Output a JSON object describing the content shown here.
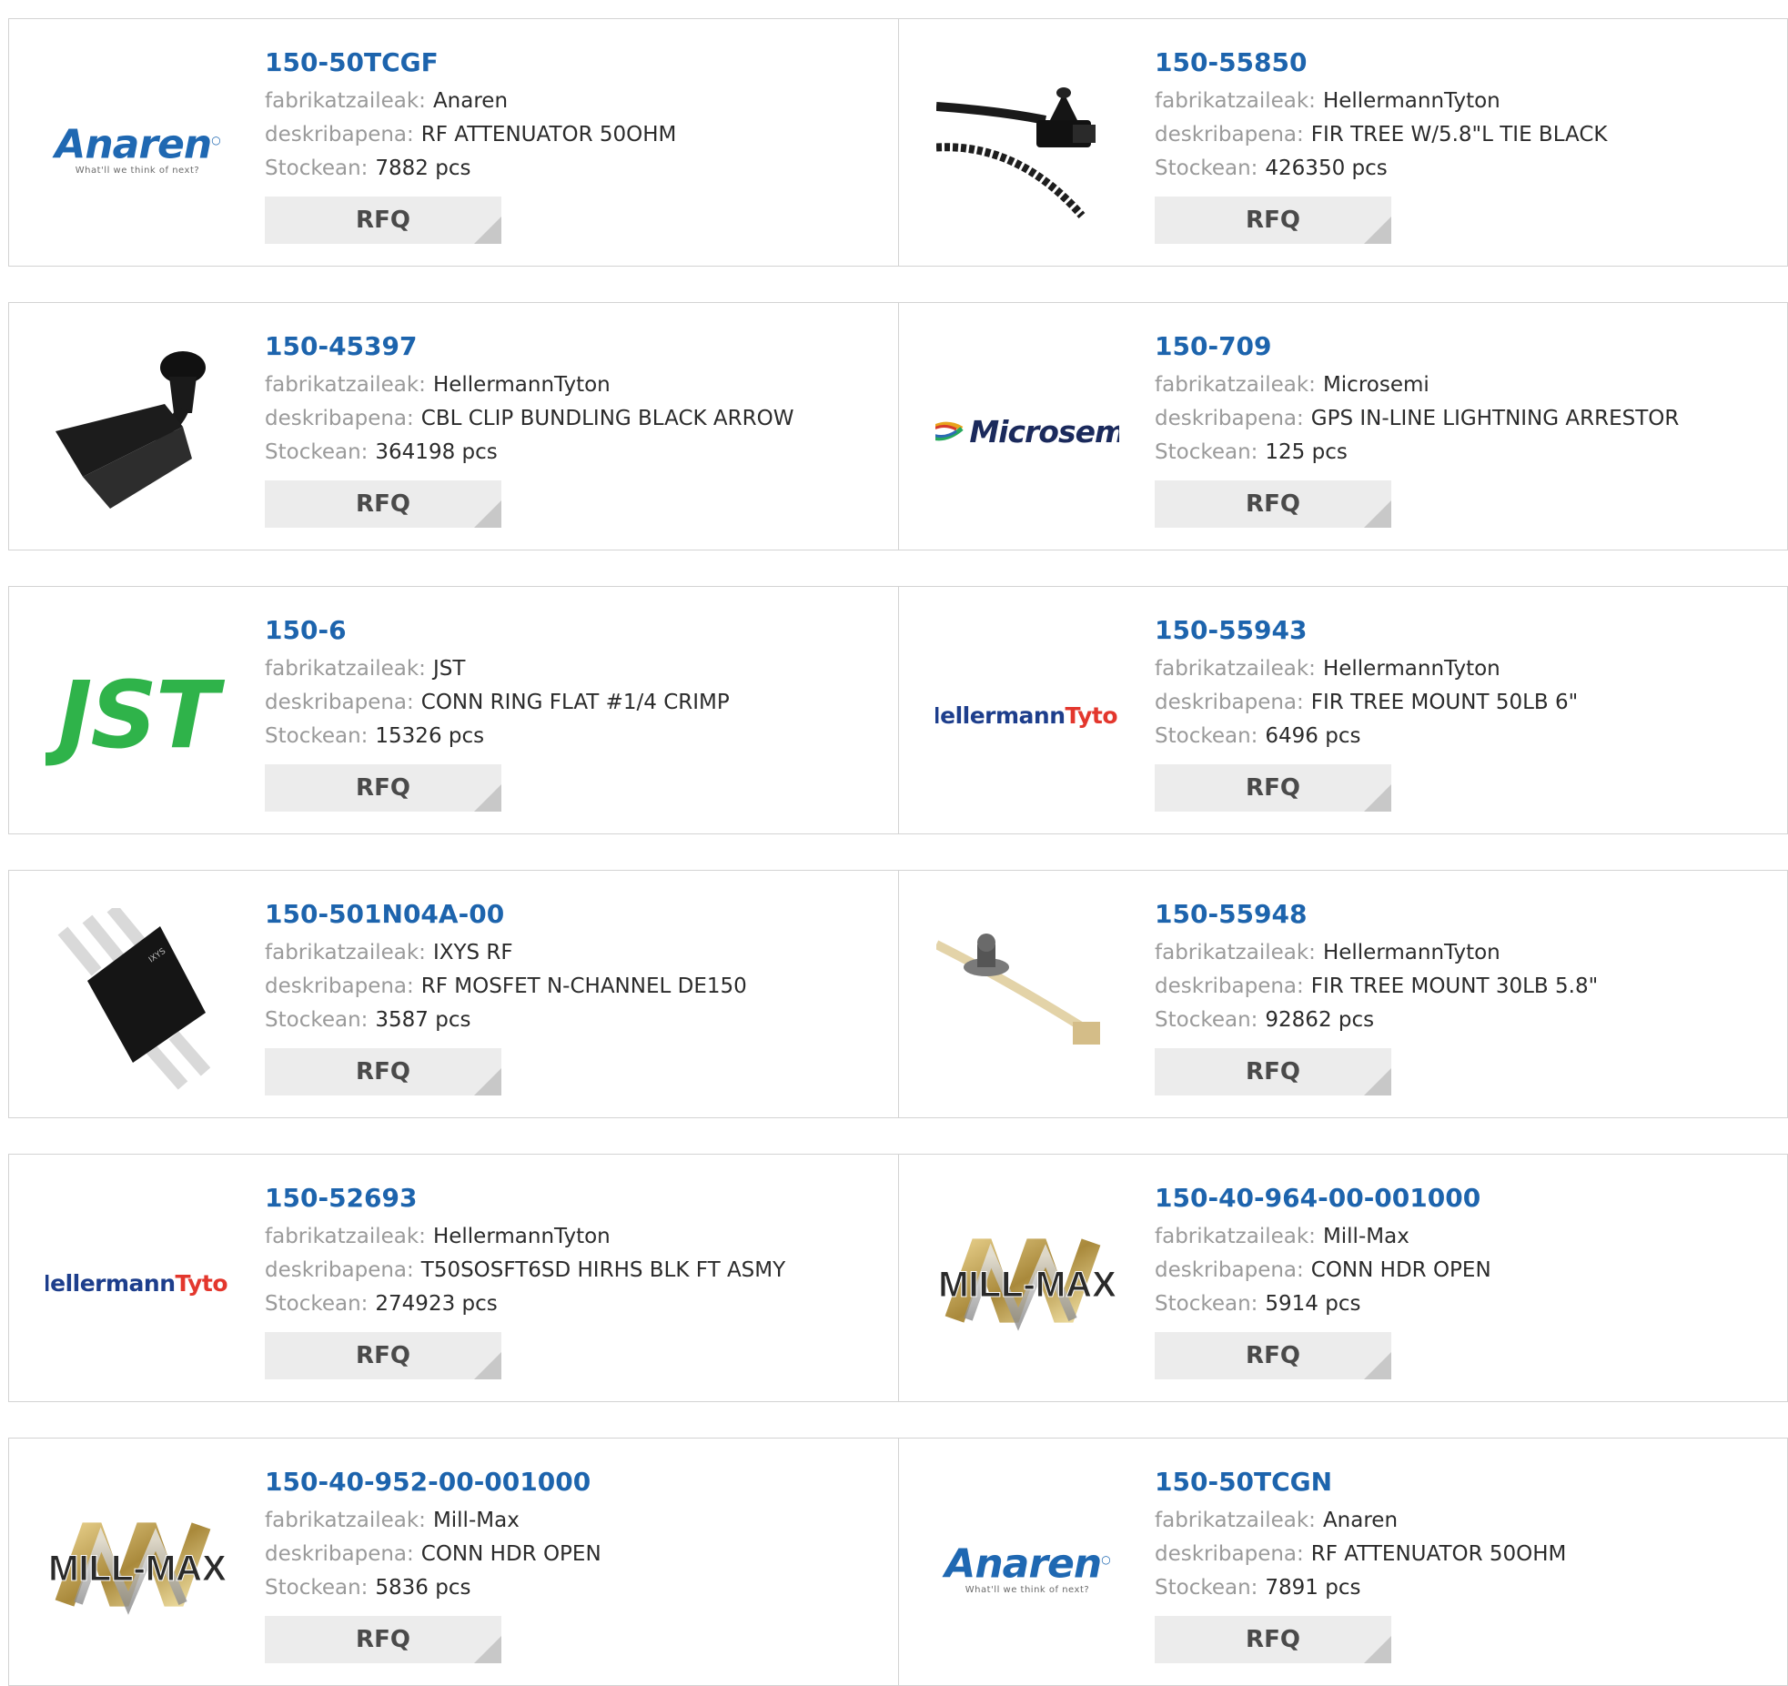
{
  "labels": {
    "manufacturer": "fabrikatzaileak:",
    "description": "deskribapena:",
    "stock": "Stockean:",
    "rfq": "RFQ"
  },
  "products": [
    {
      "part": "150-50TCGF",
      "manufacturer": "Anaren",
      "description": "RF ATTENUATOR 50OHM",
      "stock": "7882 pcs",
      "image": "anaren-logo"
    },
    {
      "part": "150-55850",
      "manufacturer": "HellermannTyton",
      "description": "FIR TREE W/5.8\"L TIE BLACK",
      "stock": "426350 pcs",
      "image": "fir-tree-black-tie-photo"
    },
    {
      "part": "150-45397",
      "manufacturer": "HellermannTyton",
      "description": "CBL CLIP BUNDLING BLACK ARROW",
      "stock": "364198 pcs",
      "image": "cable-clip-photo"
    },
    {
      "part": "150-709",
      "manufacturer": "Microsemi",
      "description": "GPS IN-LINE LIGHTNING ARRESTOR",
      "stock": "125 pcs",
      "image": "microsemi-logo"
    },
    {
      "part": "150-6",
      "manufacturer": "JST",
      "description": "CONN RING FLAT #1/4 CRIMP",
      "stock": "15326 pcs",
      "image": "jst-logo"
    },
    {
      "part": "150-55943",
      "manufacturer": "HellermannTyton",
      "description": "FIR TREE MOUNT 50LB 6\"",
      "stock": "6496 pcs",
      "image": "hellermanntyton-logo"
    },
    {
      "part": "150-501N04A-00",
      "manufacturer": "IXYS RF",
      "description": "RF MOSFET N-CHANNEL DE150",
      "stock": "3587 pcs",
      "image": "mosfet-photo"
    },
    {
      "part": "150-55948",
      "manufacturer": "HellermannTyton",
      "description": "FIR TREE MOUNT 30LB 5.8\"",
      "stock": "92862 pcs",
      "image": "fir-tree-natural-tie-photo"
    },
    {
      "part": "150-52693",
      "manufacturer": "HellermannTyton",
      "description": "T50SOSFT6SD HIRHS BLK FT ASMY",
      "stock": "274923 pcs",
      "image": "hellermanntyton-logo"
    },
    {
      "part": "150-40-964-00-001000",
      "manufacturer": "Mill-Max",
      "description": "CONN HDR OPEN",
      "stock": "5914 pcs",
      "image": "mill-max-logo"
    },
    {
      "part": "150-40-952-00-001000",
      "manufacturer": "Mill-Max",
      "description": "CONN HDR OPEN",
      "stock": "5836 pcs",
      "image": "mill-max-logo"
    },
    {
      "part": "150-50TCGN",
      "manufacturer": "Anaren",
      "description": "RF ATTENUATOR 50OHM",
      "stock": "7891 pcs",
      "image": "anaren-logo"
    }
  ],
  "logos": {
    "anaren": {
      "name": "Anaren",
      "tagline": "What'll we think of next?"
    },
    "jst": {
      "name": "JST"
    },
    "microsemi": {
      "name": "Microsemi"
    },
    "hellermann": {
      "part1": "Hellermann",
      "part2": "Tyton"
    },
    "millmax": {
      "name": "MILL-MAX"
    }
  },
  "colors": {
    "part_link": "#1d64ad",
    "label": "#9a9a9a",
    "value": "#2b2b2b",
    "rfq_bg": "#ececec",
    "border": "#d3d3d3"
  }
}
